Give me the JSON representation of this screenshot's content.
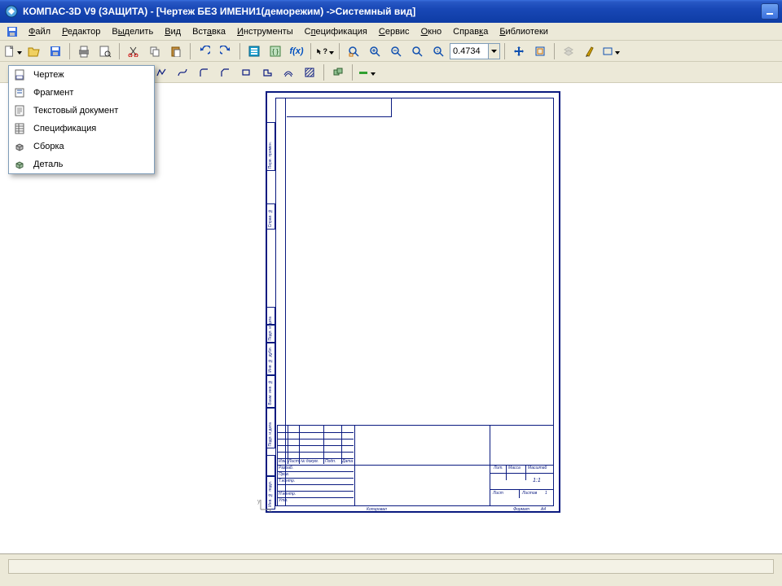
{
  "title": "КОМПАС-3D V9 (ЗАЩИТА) - [Чертеж БЕЗ ИМЕНИ1(деморежим) ->Системный вид]",
  "menubar": {
    "items": [
      "Файл",
      "Редактор",
      "Выделить",
      "Вид",
      "Вставка",
      "Инструменты",
      "Спецификация",
      "Сервис",
      "Окно",
      "Справка",
      "Библиотеки"
    ]
  },
  "toolbar1": {
    "zoom_value": "0.4734"
  },
  "new_menu": {
    "items": [
      "Чертеж",
      "Фрагмент",
      "Текстовый документ",
      "Спецификация",
      "Сборка",
      "Деталь"
    ]
  },
  "titleblock": {
    "headers": {
      "izm": "Изм.",
      "list": "Лист",
      "ndok": "№ докум.",
      "podp": "Подп.",
      "data": "Дата",
      "razrab": "Разраб.",
      "prov": "Пров.",
      "tkontr": "Т.контр.",
      "nkontr": "Н.контр.",
      "utv": "Утв.",
      "lit": "Лит.",
      "massa": "Масса",
      "masshtab": "Масштаб",
      "list2": "Лист",
      "listov": "Листов",
      "listov_val": "1",
      "scale": "1:1",
      "kopiroval": "Копировал",
      "format": "Формат",
      "format_val": "A4"
    },
    "side_labels": {
      "perv_primen": "Перв. примен.",
      "sprav_n": "Справ. №",
      "podp_data": "Подп. и дата",
      "inv_dubl": "Инв. № дубл.",
      "vzam_inv": "Взам. инв. №",
      "podp_data2": "Подп. и дата",
      "inv_podl": "Инв. № подл."
    }
  }
}
